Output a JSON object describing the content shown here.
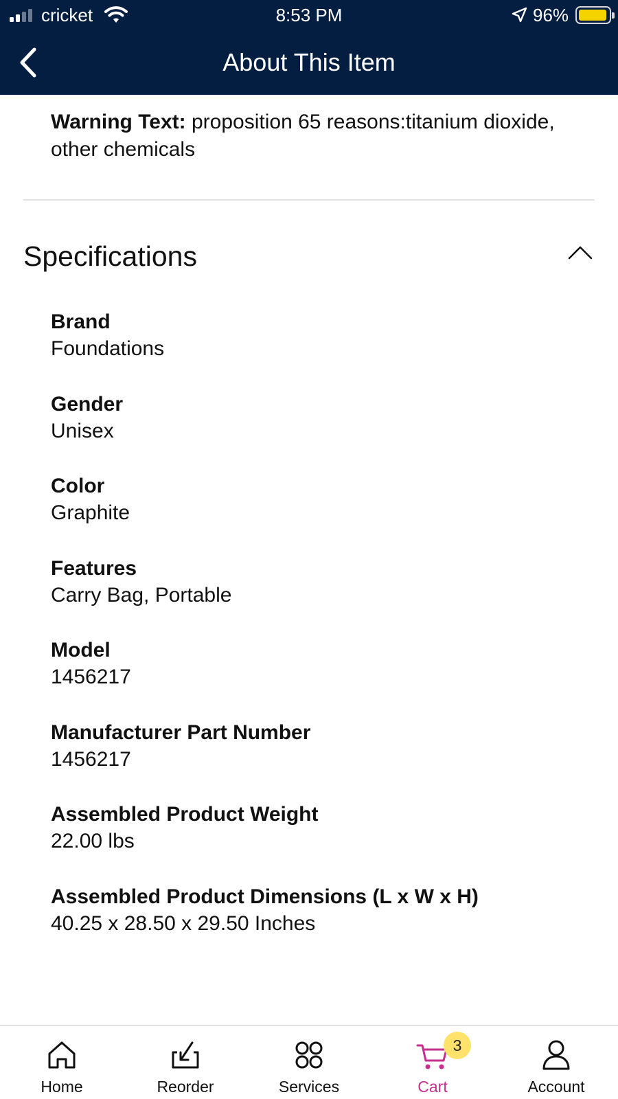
{
  "status_bar": {
    "carrier": "cricket",
    "time": "8:53 PM",
    "battery_percent": "96%",
    "battery_level": 0.96,
    "battery_color": "#f5d300"
  },
  "nav": {
    "title": "About This Item",
    "back_icon": "chevron-left-icon",
    "background": "#041e42"
  },
  "warning": {
    "label": "Warning Text:",
    "text": "proposition 65 reasons:titanium dioxide, other chemicals"
  },
  "specifications": {
    "heading": "Specifications",
    "toggle_icon": "chevron-up-icon",
    "items": [
      {
        "label": "Brand",
        "value": "Foundations"
      },
      {
        "label": "Gender",
        "value": "Unisex"
      },
      {
        "label": "Color",
        "value": "Graphite"
      },
      {
        "label": "Features",
        "value": "Carry Bag, Portable"
      },
      {
        "label": "Model",
        "value": "1456217"
      },
      {
        "label": "Manufacturer Part Number",
        "value": "1456217"
      },
      {
        "label": "Assembled Product Weight",
        "value": "22.00 lbs"
      },
      {
        "label": "Assembled Product Dimensions (L x W x H)",
        "value": "40.25 x 28.50 x 29.50 Inches"
      }
    ]
  },
  "tab_bar": {
    "active_color": "#c6308e",
    "tabs": [
      {
        "label": "Home",
        "icon": "home-icon"
      },
      {
        "label": "Reorder",
        "icon": "reorder-icon"
      },
      {
        "label": "Services",
        "icon": "services-icon"
      },
      {
        "label": "Cart",
        "icon": "cart-icon",
        "badge": "3",
        "active": true
      },
      {
        "label": "Account",
        "icon": "account-icon"
      }
    ]
  }
}
